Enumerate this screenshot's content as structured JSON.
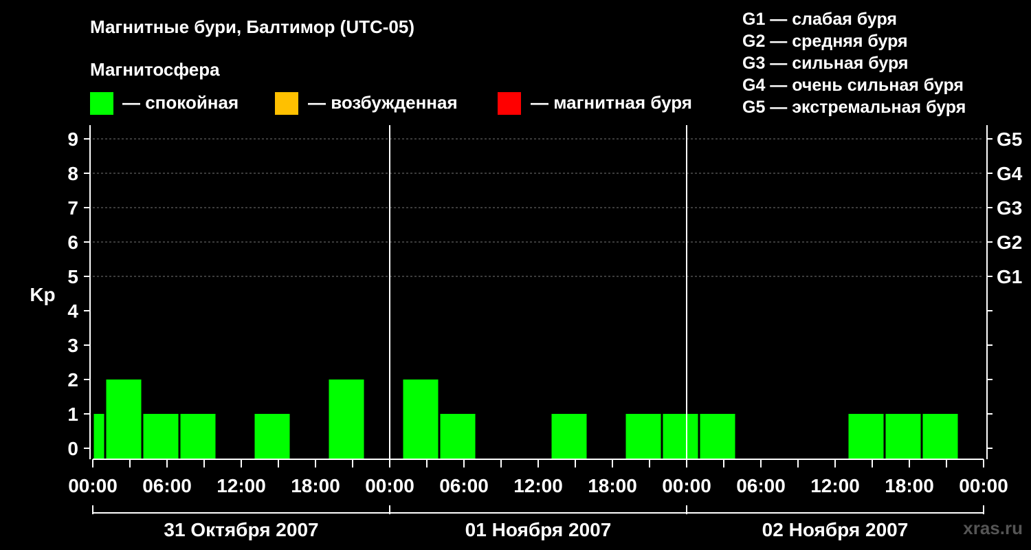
{
  "header": {
    "title": "Магнитные бури, Балтимор (UTC-05)",
    "subtitle": "Магнитосфера",
    "legend": [
      {
        "label": "— спокойная",
        "color": "#00ff00"
      },
      {
        "label": "— возбужденная",
        "color": "#ffc000"
      },
      {
        "label": "— магнитная буря",
        "color": "#ff0000"
      }
    ],
    "storm_levels": [
      "G1 — слабая буря",
      "G2 — средняя буря",
      "G3 — сильная буря",
      "G4 — очень сильная буря",
      "G5 — экстремальная буря"
    ],
    "watermark": "xras.ru"
  },
  "chart_data": {
    "type": "bar",
    "ylabel": "Kp",
    "ylim": [
      0,
      9
    ],
    "y_ticks": [
      "0",
      "1",
      "2",
      "3",
      "4",
      "5",
      "6",
      "7",
      "8",
      "9"
    ],
    "right_ticks": [
      {
        "kp": 5,
        "label": "G1"
      },
      {
        "kp": 6,
        "label": "G2"
      },
      {
        "kp": 7,
        "label": "G3"
      },
      {
        "kp": 8,
        "label": "G4"
      },
      {
        "kp": 9,
        "label": "G5"
      }
    ],
    "x_tick_labels": [
      "00:00",
      "06:00",
      "12:00",
      "18:00",
      "00:00",
      "06:00",
      "12:00",
      "18:00",
      "00:00",
      "06:00",
      "12:00",
      "18:00",
      "00:00"
    ],
    "days": [
      "31 Октября 2007",
      "01 Ноября 2007",
      "02 Ноября 2007"
    ],
    "colors": {
      "quiet": "#00ff00",
      "active": "#ffc000",
      "storm": "#ff0000"
    },
    "bars": [
      {
        "start_h": 0,
        "end_h": 1,
        "kp": 1
      },
      {
        "start_h": 1,
        "end_h": 4,
        "kp": 2
      },
      {
        "start_h": 4,
        "end_h": 7,
        "kp": 1
      },
      {
        "start_h": 7,
        "end_h": 10,
        "kp": 1
      },
      {
        "start_h": 10,
        "end_h": 13,
        "kp": 0
      },
      {
        "start_h": 13,
        "end_h": 16,
        "kp": 1
      },
      {
        "start_h": 16,
        "end_h": 19,
        "kp": 0
      },
      {
        "start_h": 19,
        "end_h": 22,
        "kp": 2
      },
      {
        "start_h": 22,
        "end_h": 25,
        "kp": 0
      },
      {
        "start_h": 25,
        "end_h": 28,
        "kp": 2
      },
      {
        "start_h": 28,
        "end_h": 31,
        "kp": 1
      },
      {
        "start_h": 31,
        "end_h": 34,
        "kp": 0
      },
      {
        "start_h": 34,
        "end_h": 37,
        "kp": 0
      },
      {
        "start_h": 37,
        "end_h": 40,
        "kp": 1
      },
      {
        "start_h": 40,
        "end_h": 43,
        "kp": 0
      },
      {
        "start_h": 43,
        "end_h": 46,
        "kp": 1
      },
      {
        "start_h": 46,
        "end_h": 49,
        "kp": 1
      },
      {
        "start_h": 49,
        "end_h": 52,
        "kp": 1
      },
      {
        "start_h": 52,
        "end_h": 55,
        "kp": 0
      },
      {
        "start_h": 55,
        "end_h": 58,
        "kp": 0
      },
      {
        "start_h": 58,
        "end_h": 61,
        "kp": 0
      },
      {
        "start_h": 61,
        "end_h": 64,
        "kp": 1
      },
      {
        "start_h": 64,
        "end_h": 67,
        "kp": 1
      },
      {
        "start_h": 67,
        "end_h": 70,
        "kp": 1
      }
    ]
  }
}
